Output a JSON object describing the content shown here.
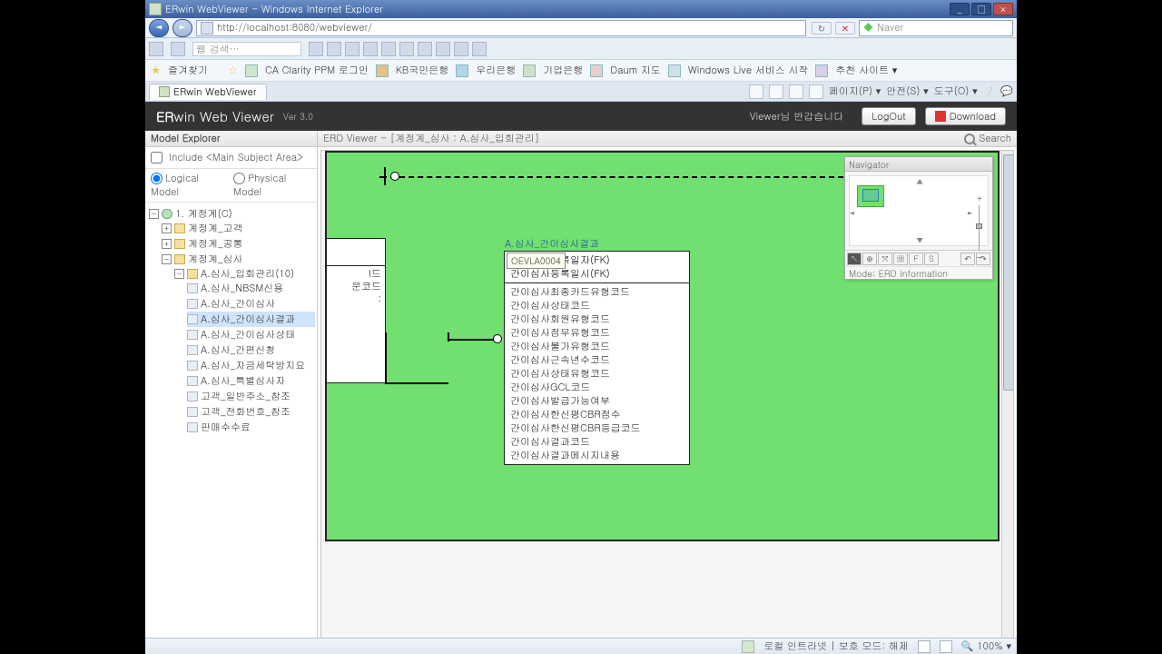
{
  "window": {
    "title": "ERwin WebViewer - Windows Internet Explorer",
    "min": "_",
    "max": "□",
    "close": "×"
  },
  "address": {
    "url": "http://localhost:8080/webviewer/",
    "search_placeholder": "Naver"
  },
  "toolbar": {
    "search_placeholder": "웹 검색…"
  },
  "bookmarks": {
    "fav": "즐겨찾기",
    "items": [
      "CA Clarity PPM 로그인",
      "KB국민은행",
      "우리은행",
      "기업은행",
      "Daum 지도",
      "Windows Live 서비스 시작",
      "추천 사이트 ▾"
    ]
  },
  "tab": {
    "label": "ERwin WebViewer"
  },
  "tabtools": {
    "items": [
      "페이지(P) ▾",
      "안전(S) ▾",
      "도구(O) ▾"
    ],
    "help": "❔"
  },
  "app": {
    "logo_bold": "ER",
    "logo_thin1": "win ",
    "logo_thin2": "Web Viewer",
    "version": "Ver 3.0",
    "welcome": "Viewer님 반갑습니다",
    "logout": "LogOut",
    "download": "Download"
  },
  "sidebar": {
    "header": "Model Explorer",
    "include_label": "Include <Main Subject Area>",
    "logical": "Logical Model",
    "physical": "Physical Model",
    "root": "1. 계정계(C)",
    "children": [
      "계정계_고객",
      "계정계_공통",
      "계정계_심사"
    ],
    "sa_parent": "A.심사_입회관리(10)",
    "sa_items": [
      "A.심사_NBSM신용",
      "A.심사_간이심사",
      "A.심사_간이심사결과",
      "A.심사_간이심사상태",
      "A.심사_간편신청",
      "A.심사_자금세탁방지요",
      "A.심사_특별심사자",
      "고객_일반주소_참조",
      "고객_전화번호_참조",
      "판매수수료"
    ],
    "selected_index": 2
  },
  "erd": {
    "header": "ERD Viewer - [계정계_심사 : A.심사_입회관리]",
    "search": "Search",
    "navigator": "Navigator",
    "mode": "Mode: ERD Information",
    "tooltip": "OEVLA0004",
    "entity": {
      "name": "A.심사_간이심사결과",
      "pk": [
        "간이심사등록일자(FK)",
        "간이심사등록일시(FK)"
      ],
      "attrs": [
        "간이심사최종카드유형코드",
        "간이심사상태코드",
        "간이심사회원유형코드",
        "간이심사점무유형코드",
        "간이심사불가유형코드",
        "간이심사근속년수코드",
        "간이심사상태유형코드",
        "간이심사GCL코드",
        "간이심사발급가능여부",
        "간이심사한신평CBR점수",
        "간이심사한신평CBR등급코드",
        "간이심사결과코드",
        "간이심사결과메시지내용"
      ]
    },
    "left_entity_attrs": [
      "I드",
      "문코드"
    ]
  },
  "status": {
    "zone": "로컬 인트라넷 | 보호 모드: 해제",
    "zoom": "100%"
  }
}
